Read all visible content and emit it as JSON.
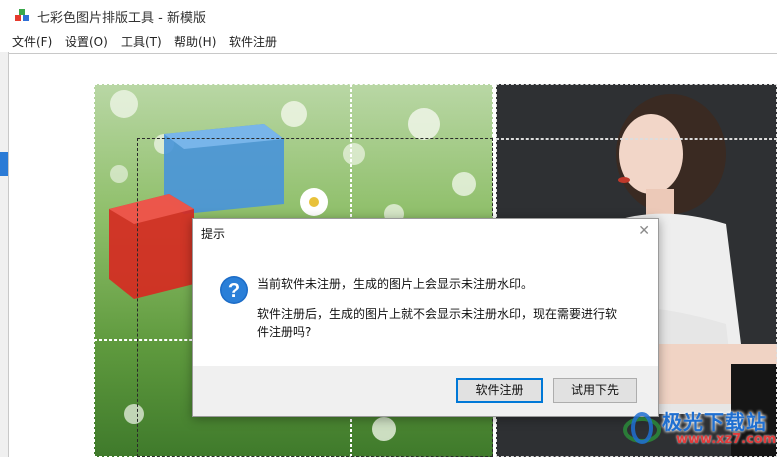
{
  "window": {
    "title": "七彩色图片排版工具 - 新模版"
  },
  "menu": {
    "items": [
      "文件(F)",
      "设置(O)",
      "工具(T)",
      "帮助(H)",
      "软件注册"
    ]
  },
  "dialog": {
    "title": "提示",
    "message_line1": "当前软件未注册，生成的图片上会显示未注册水印。",
    "message_line2": "软件注册后，生成的图片上就不会显示未注册水印，现在需要进行软件注册吗?",
    "buttons": {
      "register": "软件注册",
      "try": "试用下先"
    },
    "icon": "question-icon"
  },
  "watermark": {
    "text": "极光下载站",
    "url": "www.xz7.com"
  },
  "colors": {
    "accent": "#0078d7",
    "footer": "#f0f0f0",
    "watermark_blue": "#1f6fd1",
    "watermark_red": "#e23b3b"
  }
}
